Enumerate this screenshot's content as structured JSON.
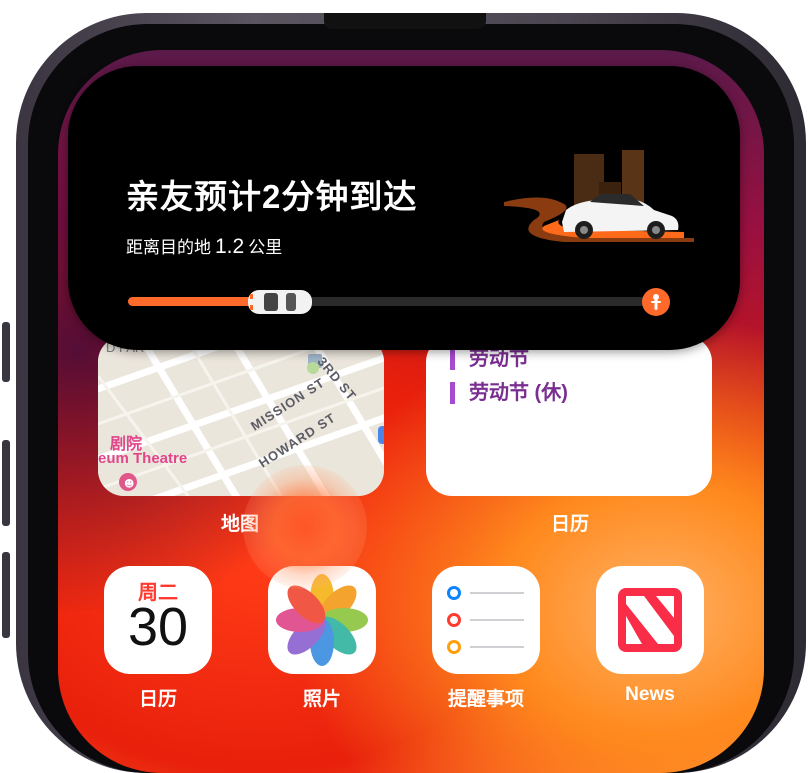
{
  "live_activity": {
    "title": "亲友预计2分钟到达",
    "distance_prefix": "距离目的地",
    "distance_value": "1.2",
    "distance_unit": "公里",
    "progress": 0.27
  },
  "map_widget": {
    "label": "地图",
    "streets": [
      "MISSION ST",
      "HOWARD ST",
      "3RD ST"
    ],
    "place_cn": "剧院",
    "place_en": "eum Theatre"
  },
  "calendar_widget": {
    "label": "日历",
    "events": [
      "劳动节",
      "劳动节 (休)"
    ]
  },
  "apps": [
    {
      "label": "日历",
      "weekday": "周二",
      "day": "30",
      "icon": "calendar-icon"
    },
    {
      "label": "照片",
      "icon": "photos-icon"
    },
    {
      "label": "提醒事项",
      "icon": "reminders-icon"
    },
    {
      "label": "News",
      "icon": "news-icon"
    }
  ],
  "colors": {
    "accent": "#ff6a2a",
    "calendar_event": "#a64bd0",
    "news_red": "#fa2d48"
  }
}
